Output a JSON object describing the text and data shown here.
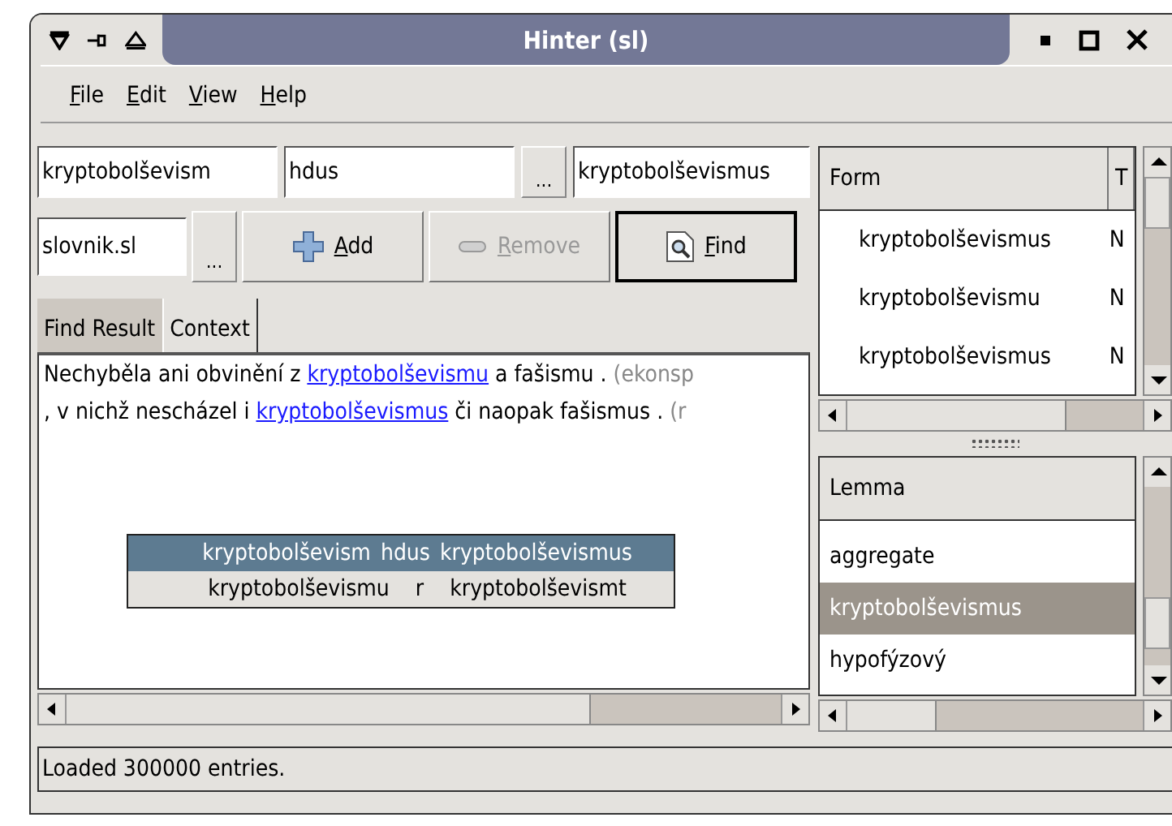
{
  "window": {
    "title": "Hinter (sl)"
  },
  "menu": [
    "File",
    "Edit",
    "View",
    "Help"
  ],
  "fields": {
    "word": "kryptobolševism",
    "tag": "hdus",
    "lemma": "kryptobolševismus",
    "dictionary": "slovnik.sl"
  },
  "browse_buttons": [
    "...",
    "..."
  ],
  "buttons": [
    {
      "label": "Add",
      "disabled": false,
      "default": false,
      "kind": "add"
    },
    {
      "label": "Remove",
      "disabled": true,
      "default": false,
      "kind": "remove"
    },
    {
      "label": "Find",
      "disabled": false,
      "default": true,
      "kind": "find"
    }
  ],
  "tabs": [
    {
      "label": "Find Result",
      "selected": false
    },
    {
      "label": "Context",
      "selected": true
    }
  ],
  "context_lines": [
    [
      {
        "kind": "text",
        "text": "Nechyběla ani obvinění z "
      },
      {
        "kind": "link",
        "text": "kryptobolševismu"
      },
      {
        "kind": "text",
        "text": " a fašismu . "
      },
      {
        "kind": "source",
        "text": "(ekonsp"
      }
    ],
    [
      {
        "kind": "text",
        "text": ", v nichž nescházel i "
      },
      {
        "kind": "link",
        "text": "kryptobolševismus"
      },
      {
        "kind": "text",
        "text": " či naopak fašismus . "
      },
      {
        "kind": "source",
        "text": "(r"
      }
    ]
  ],
  "completions": [
    {
      "cells": [
        "kryptobolševism",
        "hdus",
        "kryptobolševismus"
      ],
      "selected": true
    },
    {
      "cells": [
        "kryptobolševismu",
        "r",
        "kryptobolševismt"
      ],
      "selected": false
    }
  ],
  "form_table": {
    "columns": [
      "Form",
      "T"
    ],
    "rows": [
      [
        "kryptobolševismus",
        "N"
      ],
      [
        "kryptobolševismu",
        "N"
      ],
      [
        "kryptobolševismus",
        "N"
      ]
    ]
  },
  "lemma_list": {
    "column": "Lemma",
    "items": [
      {
        "label": "aggregate",
        "selected": false
      },
      {
        "label": "kryptobolševismus",
        "selected": true
      },
      {
        "label": "hypofýzový",
        "selected": false
      }
    ]
  },
  "status_bar": "Loaded 300000 entries."
}
